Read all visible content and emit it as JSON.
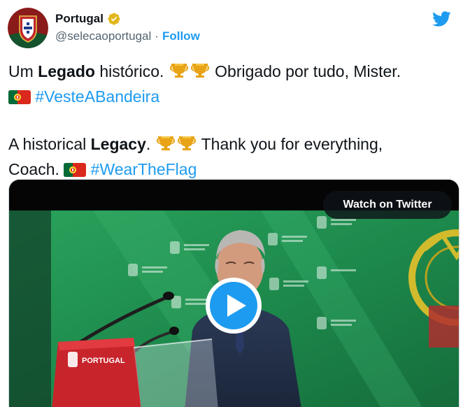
{
  "account": {
    "display_name": "Portugal",
    "handle": "@selecaoportugal",
    "separator": "·",
    "follow_label": "Follow"
  },
  "tweet": {
    "line1_part1": "Um ",
    "line1_bold": "Legado",
    "line1_part2": " histórico. ",
    "line1_part3": " Obrigado por tudo, Mister.",
    "hashtag1": "#VesteABandeira",
    "line3_part1": "A historical ",
    "line3_bold": "Legacy",
    "line3_part2": ". ",
    "line3_part3": " Thank you for everything,",
    "line4_part1": "Coach. ",
    "hashtag2": "#WearTheFlag"
  },
  "media": {
    "watch_label": "Watch on Twitter",
    "podium_text": "PORTUGAL"
  },
  "icons": {
    "verified": "verified-badge-icon",
    "twitter": "twitter-bird-icon",
    "trophy": "trophy-icon",
    "flag": "portugal-flag-icon",
    "play": "play-icon"
  },
  "colors": {
    "link": "#1d9bf0",
    "verified_gold": "#e2b719",
    "video_green": "#1f9a54"
  }
}
